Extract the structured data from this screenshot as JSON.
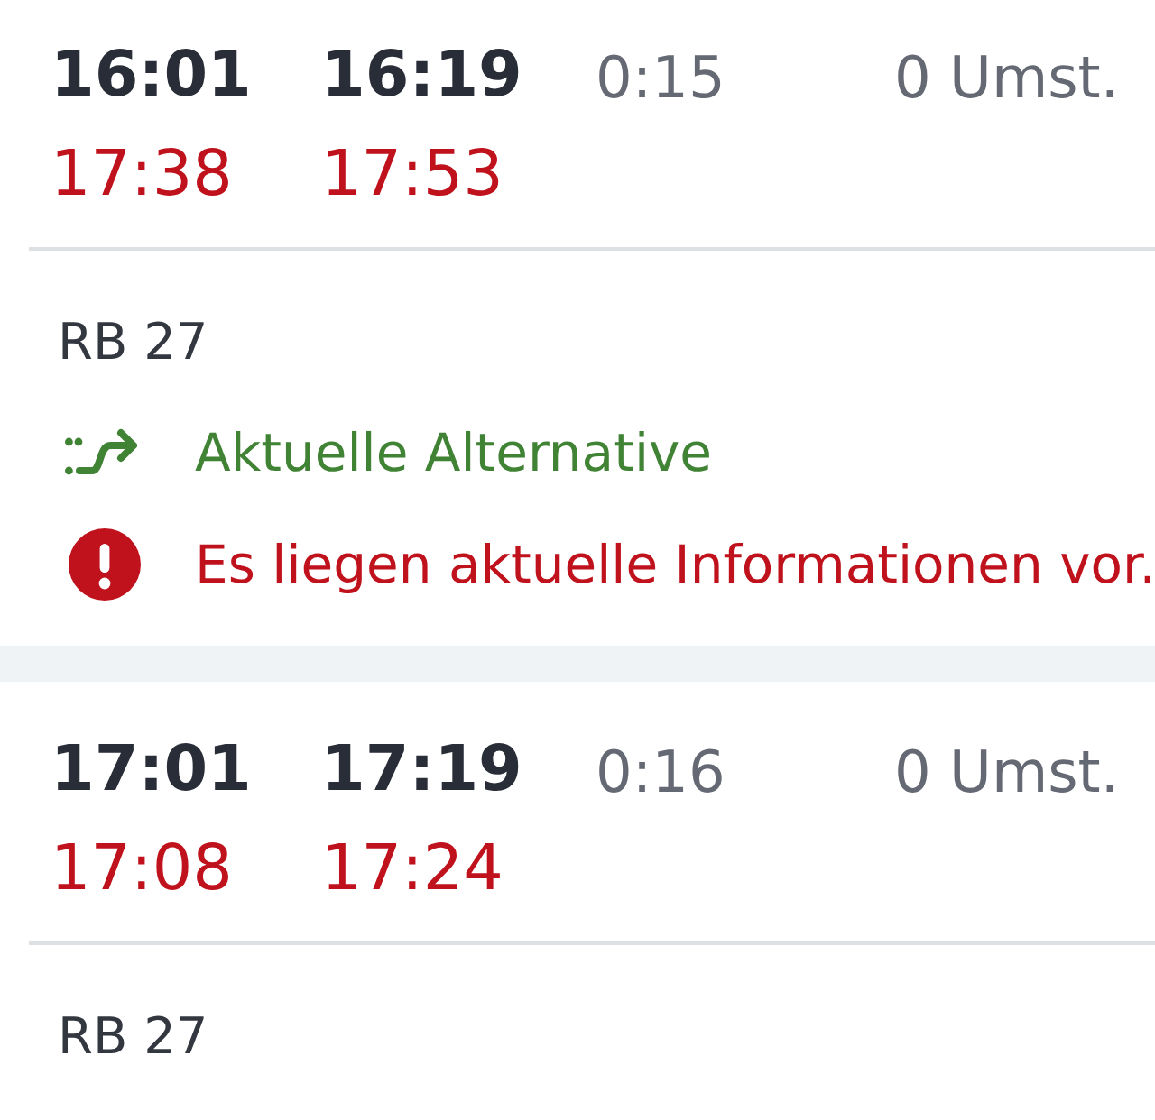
{
  "connections": [
    {
      "departure": {
        "scheduled": "16:01",
        "realtime": "17:38"
      },
      "arrival": {
        "scheduled": "16:19",
        "realtime": "17:53"
      },
      "duration": "0:15",
      "transfers": "0 Umst.",
      "line": "RB 27",
      "notices": [
        {
          "kind": "alternative",
          "text": "Aktuelle Alternative"
        },
        {
          "kind": "warning",
          "text": "Es liegen aktuelle Informationen vor."
        }
      ]
    },
    {
      "departure": {
        "scheduled": "17:01",
        "realtime": "17:08"
      },
      "arrival": {
        "scheduled": "17:19",
        "realtime": "17:24"
      },
      "duration": "0:16",
      "transfers": "0 Umst.",
      "line": "RB 27"
    }
  ]
}
